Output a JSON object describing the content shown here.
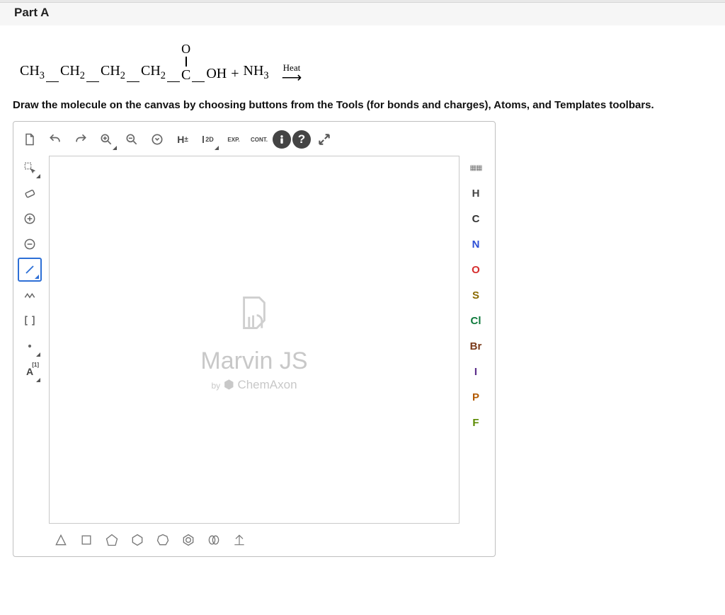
{
  "header": {
    "part_label": "Part A"
  },
  "reaction": {
    "frag1": "CH",
    "sub1": "3",
    "frag2": "CH",
    "sub2": "2",
    "frag3": "CH",
    "sub3": "2",
    "frag4": "CH",
    "sub4": "2",
    "carbonyl_o": "O",
    "carbonyl_c": "C",
    "oh": "OH",
    "plus": "+",
    "nh": "NH",
    "nh_sub": "3",
    "heat": "Heat"
  },
  "instruction": "Draw the molecule on the canvas by choosing buttons from the Tools (for bonds and charges), Atoms, and Templates toolbars.",
  "toolbar_top": {
    "h_btn": "H",
    "h_pm": "±",
    "twoD": "2D",
    "exp": "EXP.",
    "cont": "CONT."
  },
  "toolbar_left": {
    "map_label": "A",
    "map_sup": "[1]"
  },
  "canvas": {
    "title": "Marvin JS",
    "by": "by",
    "brand": "ChemAxon"
  },
  "atoms": {
    "H": "H",
    "C": "C",
    "N": "N",
    "O": "O",
    "S": "S",
    "Cl": "Cl",
    "Br": "Br",
    "I": "I",
    "P": "P",
    "F": "F"
  }
}
